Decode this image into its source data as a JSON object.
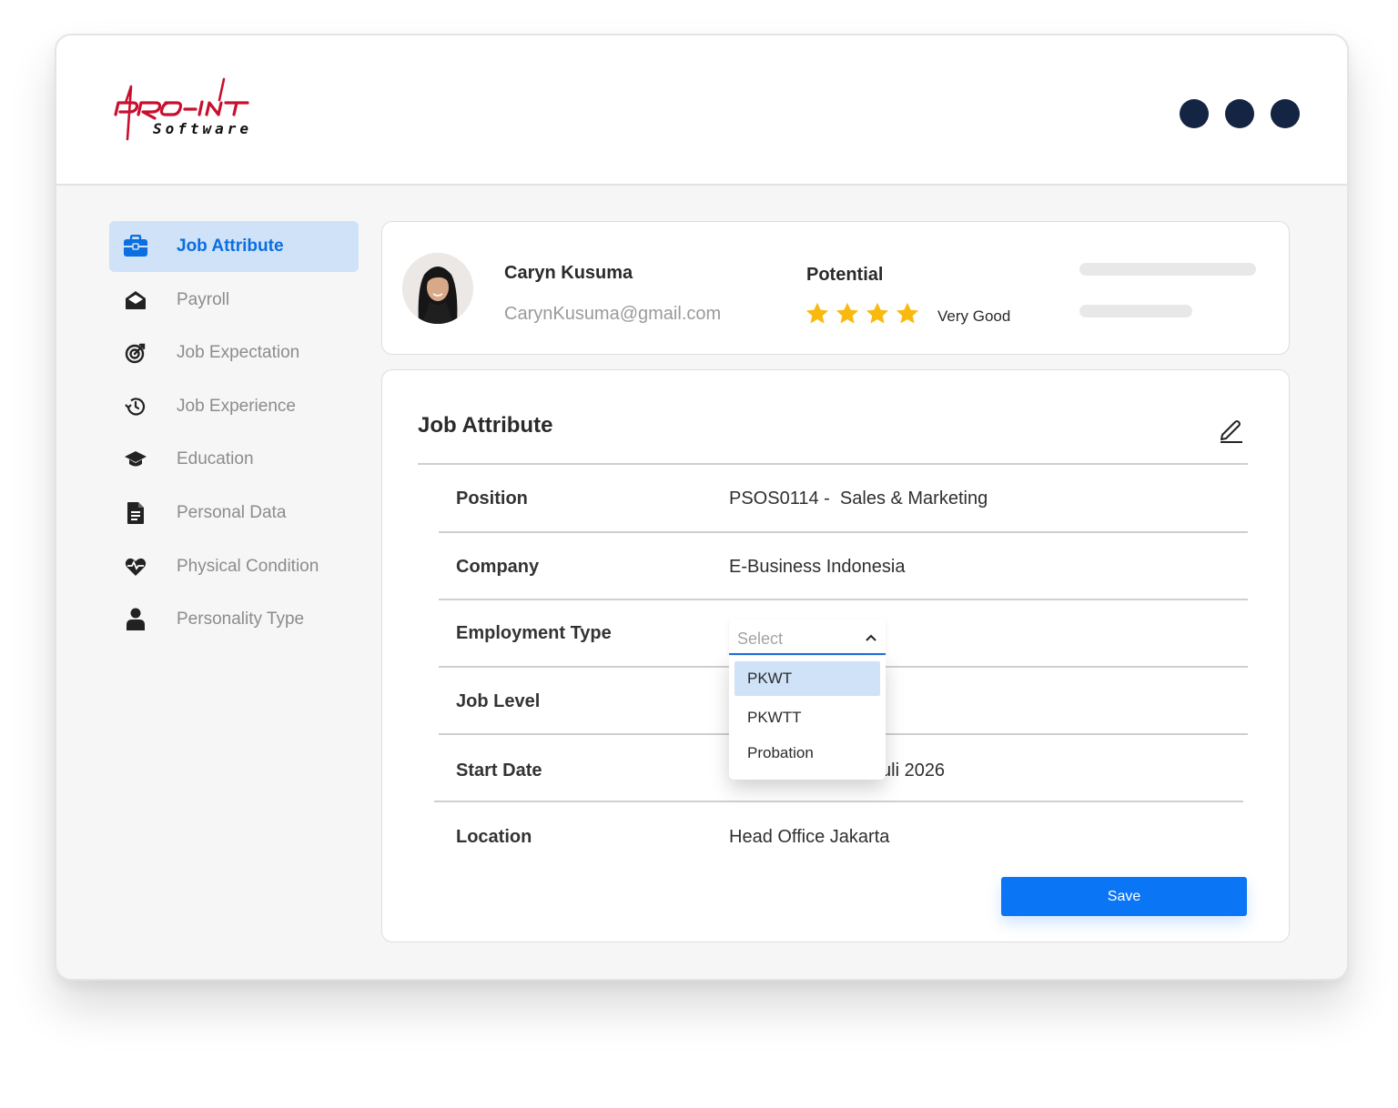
{
  "brand": {
    "logo_text": "PRO-INT",
    "logo_sub": "Software"
  },
  "sidebar": {
    "items": [
      {
        "label": "Job Attribute",
        "icon": "briefcase-icon",
        "active": true
      },
      {
        "label": "Payroll",
        "icon": "envelope-open-icon",
        "active": false
      },
      {
        "label": "Job Expectation",
        "icon": "target-icon",
        "active": false
      },
      {
        "label": "Job Experience",
        "icon": "history-icon",
        "active": false
      },
      {
        "label": "Education",
        "icon": "graduation-cap-icon",
        "active": false
      },
      {
        "label": "Personal Data",
        "icon": "document-icon",
        "active": false
      },
      {
        "label": "Physical Condition",
        "icon": "heart-pulse-icon",
        "active": false
      },
      {
        "label": "Personality Type",
        "icon": "user-icon",
        "active": false
      }
    ]
  },
  "profile": {
    "name": "Caryn Kusuma",
    "email": "CarynKusuma@gmail.com",
    "potential_label": "Potential",
    "stars": 4,
    "rating_text": "Very Good"
  },
  "job_attribute": {
    "title": "Job Attribute",
    "rows": [
      {
        "label": "Position",
        "value": "PSOS0114 -  Sales & Marketing"
      },
      {
        "label": "Company",
        "value": "E-Business Indonesia"
      },
      {
        "label": "Employment Type",
        "value": ""
      },
      {
        "label": "Job Level",
        "value": ""
      },
      {
        "label": "Start Date",
        "value": "uli 2026"
      },
      {
        "label": "Location",
        "value": "Head Office Jakarta"
      }
    ],
    "employment_select": {
      "placeholder": "Select",
      "options": [
        "PKWT",
        "PKWTT",
        "Probation"
      ],
      "highlighted": "PKWT"
    },
    "save_label": "Save"
  },
  "colors": {
    "accent": "#0a75f5",
    "active_bg": "#cfe2f8",
    "star": "#f9b90f",
    "brand_red": "#c8102e",
    "dots": "#142543"
  }
}
